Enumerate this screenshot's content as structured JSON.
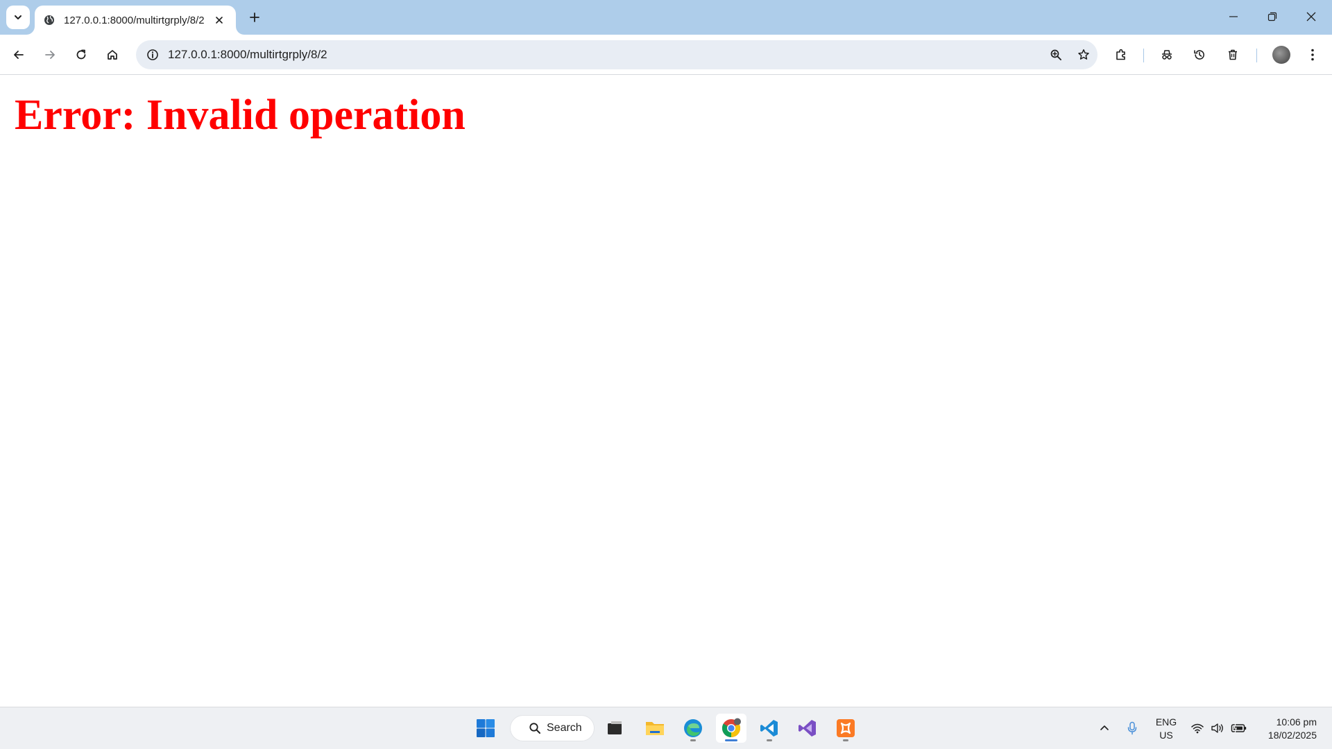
{
  "browser": {
    "tab": {
      "title": "127.0.0.1:8000/multirtgrply/8/2",
      "favicon": "globe-icon"
    },
    "address_bar": {
      "url": "127.0.0.1:8000/multirtgrply/8/2"
    },
    "toolbar_icons": [
      "back-icon",
      "forward-icon",
      "reload-icon",
      "home-icon",
      "site-info-icon",
      "zoom-icon",
      "bookmark-star-icon",
      "extensions-icon",
      "incognito-icon",
      "history-icon",
      "delete-icon",
      "profile-avatar",
      "menu-icon"
    ],
    "window_controls": [
      "minimize-icon",
      "restore-icon",
      "close-icon"
    ]
  },
  "page": {
    "error_message": "Error: Invalid operation",
    "error_color": "#ff0000"
  },
  "taskbar": {
    "search_label": "Search",
    "apps": [
      "windows-start-icon",
      "search-icon",
      "task-view-icon",
      "file-explorer-icon",
      "edge-icon",
      "chrome-icon",
      "vscode-icon",
      "visual-studio-icon",
      "xampp-icon"
    ],
    "active_app": "chrome-icon",
    "tray": {
      "language_line1": "ENG",
      "language_line2": "US",
      "time": "10:06 pm",
      "date": "18/02/2025"
    }
  },
  "colors": {
    "tabstrip": "#aecdea",
    "omnibox": "#e8edf4",
    "taskbar": "#eef0f3",
    "accent": "#3f7fd6"
  }
}
